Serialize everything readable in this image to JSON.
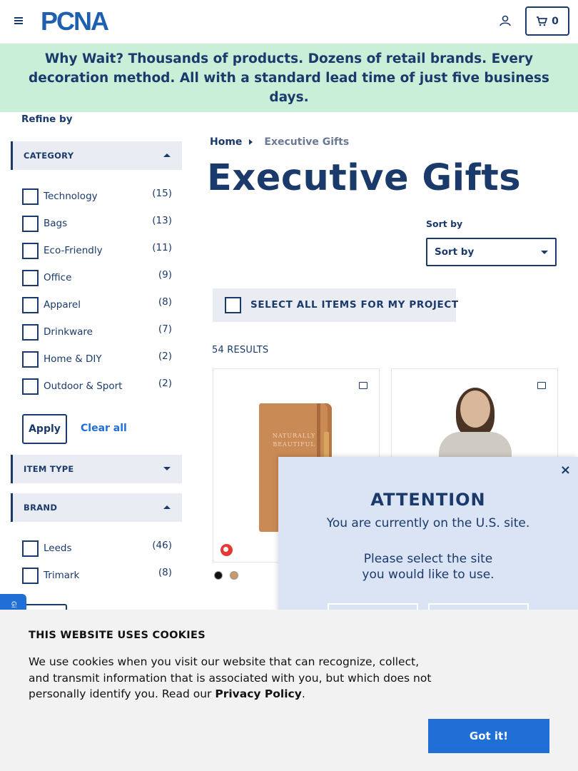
{
  "header": {
    "logo_text": "PCNA",
    "cart_count": "0"
  },
  "promo": {
    "lead": "Why Wait?",
    "text": "Thousands of products. Dozens of retail brands. Every decoration method. All with a standard lead time of just five business days."
  },
  "sidebar": {
    "refine_label": "Refine by",
    "category": {
      "title": "CATEGORY",
      "items": [
        {
          "label": "Technology",
          "count": "(15)"
        },
        {
          "label": "Bags",
          "count": "(13)"
        },
        {
          "label": "Eco-Friendly",
          "count": "(11)"
        },
        {
          "label": "Office",
          "count": "(9)"
        },
        {
          "label": "Apparel",
          "count": "(8)"
        },
        {
          "label": "Drinkware",
          "count": "(7)"
        },
        {
          "label": "Home & DIY",
          "count": "(2)"
        },
        {
          "label": "Outdoor & Sport",
          "count": "(2)"
        }
      ]
    },
    "apply_label": "Apply",
    "clear_label": "Clear all",
    "item_type": {
      "title": "ITEM TYPE"
    },
    "brand": {
      "title": "BRAND",
      "items": [
        {
          "label": "Leeds",
          "count": "(46)"
        },
        {
          "label": "Trimark",
          "count": "(8)"
        }
      ]
    }
  },
  "main": {
    "breadcrumb": {
      "home": "Home",
      "current": "Executive Gifts"
    },
    "title": "Executive Gifts",
    "sort": {
      "label": "Sort by",
      "value": "Sort by"
    },
    "select_all": "SELECT ALL ITEMS FOR MY PROJECT",
    "results": "54 RESULTS",
    "notebook_text": "NATURALLY BEAUTIFUL"
  },
  "side_tab": "Gi",
  "modal": {
    "close": "×",
    "title": "ATTENTION",
    "line1": "You are currently on the U.S. site.",
    "line2": "Please select the site you would like to use."
  },
  "cookie": {
    "title": "THIS WEBSITE USES COOKIES",
    "text": "We use cookies when you visit our website that can recognize, collect, and transmit information that is associated with you, but which does not personally identify you. Read our ",
    "link": "Privacy Policy",
    "end": ".",
    "button": "Got it!"
  },
  "colors": {
    "brand_navy": "#1a3a6b",
    "link_blue": "#1f6fd6",
    "promo_bg": "#c9efd9",
    "modal_bg": "#dbe4f5"
  }
}
